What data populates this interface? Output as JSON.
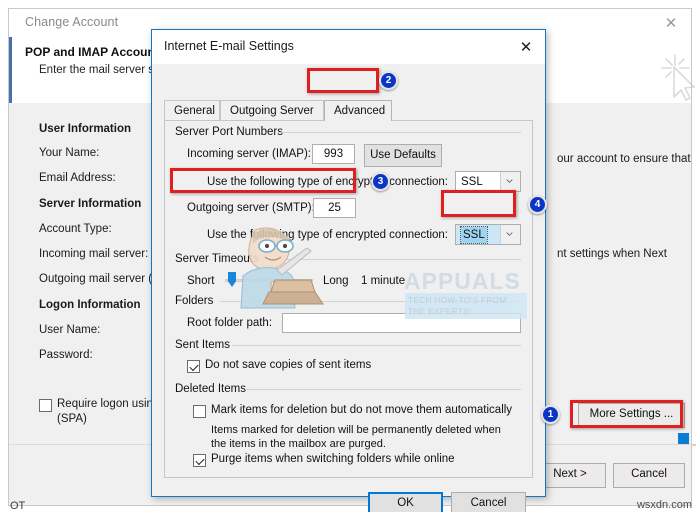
{
  "background_window": {
    "title": "Change Account",
    "close_icon": "close-icon",
    "cursor_icon": "cursor-sparkle-icon",
    "heading": "POP and IMAP Account Settings",
    "subheading": "Enter the mail server settings for your account.",
    "right_text_1": "our account to ensure that",
    "right_text_2": "nt settings when Next",
    "fields": [
      {
        "label": "User Information",
        "bold": true
      },
      {
        "label": "Your Name:",
        "bold": false
      },
      {
        "label": "Email Address:",
        "bold": false
      },
      {
        "label": "Server Information",
        "bold": true
      },
      {
        "label": "Account Type:",
        "bold": false
      },
      {
        "label": "Incoming mail server:",
        "bold": false
      },
      {
        "label": "Outgoing mail server (S",
        "bold": false
      },
      {
        "label": "Logon Information",
        "bold": true
      },
      {
        "label": "User Name:",
        "bold": false
      },
      {
        "label": "Password:",
        "bold": false
      }
    ],
    "spa_checkbox": {
      "label_line1": "Require logon using",
      "label_line2": "(SPA)",
      "checked": false
    },
    "more_settings_button": "More Settings ...",
    "next_button": "Next >",
    "cancel_button": "Cancel",
    "bottom_fragment": "OT"
  },
  "dialog": {
    "title": "Internet E-mail Settings",
    "close_icon": "close-icon",
    "tabs": [
      {
        "label": "General",
        "selected": false
      },
      {
        "label": "Outgoing Server",
        "selected": false
      },
      {
        "label": "Advanced",
        "selected": true
      }
    ],
    "groups": {
      "server_port_numbers": {
        "title": "Server Port Numbers",
        "incoming_label": "Incoming server (IMAP):",
        "incoming_value": "993",
        "use_defaults_button": "Use Defaults",
        "incoming_encryption_label": "Use the following type of encrypted connection:",
        "incoming_encryption_value": "SSL",
        "outgoing_label": "Outgoing server (SMTP):",
        "outgoing_value": "25",
        "outgoing_encryption_label": "Use the following type of encrypted connection:",
        "outgoing_encryption_value": "SSL"
      },
      "server_timeouts": {
        "title": "Server Timeouts",
        "short_label": "Short",
        "long_label": "Long",
        "value_label": "1 minute"
      },
      "folders": {
        "title": "Folders",
        "root_folder_label": "Root folder path:",
        "root_folder_value": ""
      },
      "sent_items": {
        "title": "Sent Items",
        "do_not_save_label": "Do not save copies of sent items",
        "do_not_save_checked": true
      },
      "deleted_items": {
        "title": "Deleted Items",
        "mark_label": "Mark items for deletion but do not move them automatically",
        "mark_checked": false,
        "note_line1": "Items marked for deletion will be permanently deleted when",
        "note_line2": "the items in the mailbox are purged.",
        "purge_label": "Purge items when switching folders while online",
        "purge_checked": true
      }
    },
    "ok_button": "OK",
    "cancel_button": "Cancel"
  },
  "annotations": {
    "badges": [
      {
        "number": "1",
        "target": "more-settings-button"
      },
      {
        "number": "2",
        "target": "advanced-tab"
      },
      {
        "number": "3",
        "target": "outgoing-smtp-port-row"
      },
      {
        "number": "4",
        "target": "outgoing-encryption-combo"
      }
    ],
    "highlight_color": "#e02020",
    "badge_color": "#0b35c6"
  },
  "watermark": {
    "brand": "APPUALS",
    "tagline_line1": "TECH HOW-TO'S FROM",
    "tagline_line2": "THE EXPERTS!",
    "mascot_icon": "mascot-laptop-icon"
  },
  "footer_watermark": "wsxdn.com"
}
